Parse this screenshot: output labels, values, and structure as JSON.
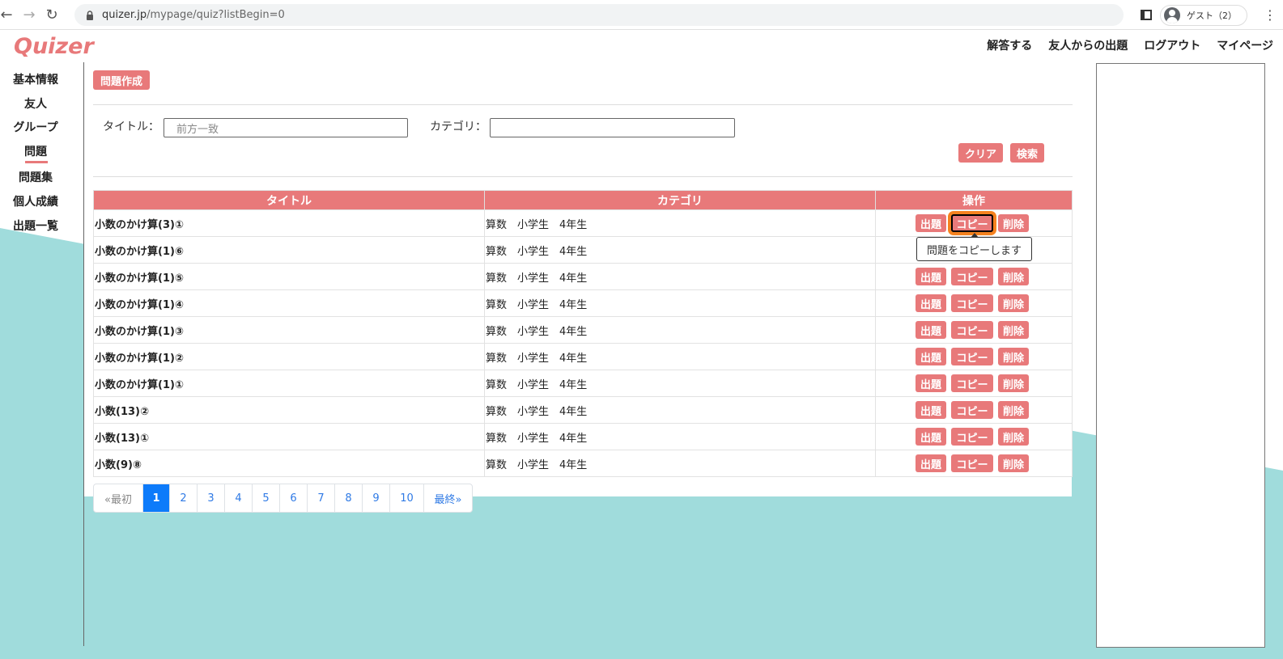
{
  "browser": {
    "url_host": "quizer.jp",
    "url_path": "/mypage/quiz?listBegin=0",
    "profile_label": "ゲスト（2）"
  },
  "header": {
    "logo": "Quizer",
    "nav": [
      "解答する",
      "友人からの出題",
      "ログアウト",
      "マイページ"
    ]
  },
  "sidebar": {
    "items": [
      {
        "label": "基本情報"
      },
      {
        "label": "友人"
      },
      {
        "label": "グループ"
      },
      {
        "label": "問題",
        "active": true
      },
      {
        "label": "問題集"
      },
      {
        "label": "個人成績"
      },
      {
        "label": "出題一覧"
      }
    ]
  },
  "toolbar": {
    "create_label": "問題作成"
  },
  "search": {
    "title_label": "タイトル：",
    "title_placeholder": "前方一致",
    "category_label": "カテゴリ：",
    "category_value": "",
    "clear_label": "クリア",
    "search_label": "検索"
  },
  "table": {
    "headers": [
      "タイトル",
      "カテゴリ",
      "操作"
    ],
    "ops": {
      "issue": "出題",
      "copy": "コピー",
      "delete": "削除"
    },
    "rows": [
      {
        "title": "小数のかけ算(3)①",
        "category": "算数　小学生　4年生"
      },
      {
        "title": "小数のかけ算(1)⑥",
        "category": "算数　小学生　4年生"
      },
      {
        "title": "小数のかけ算(1)⑤",
        "category": "算数　小学生　4年生"
      },
      {
        "title": "小数のかけ算(1)④",
        "category": "算数　小学生　4年生"
      },
      {
        "title": "小数のかけ算(1)③",
        "category": "算数　小学生　4年生"
      },
      {
        "title": "小数のかけ算(1)②",
        "category": "算数　小学生　4年生"
      },
      {
        "title": "小数のかけ算(1)①",
        "category": "算数　小学生　4年生"
      },
      {
        "title": "小数(13)②",
        "category": "算数　小学生　4年生"
      },
      {
        "title": "小数(13)①",
        "category": "算数　小学生　4年生"
      },
      {
        "title": "小数(9)⑧",
        "category": "算数　小学生　4年生"
      }
    ],
    "tooltip": "問題をコピーします"
  },
  "pagination": {
    "first": "«最初",
    "pages": [
      "1",
      "2",
      "3",
      "4",
      "5",
      "6",
      "7",
      "8",
      "9",
      "10"
    ],
    "last": "最終»",
    "current": "1"
  },
  "colors": {
    "accent": "#e8797a",
    "teal": "#a0dcdc",
    "active_page": "#0d7bfa"
  }
}
